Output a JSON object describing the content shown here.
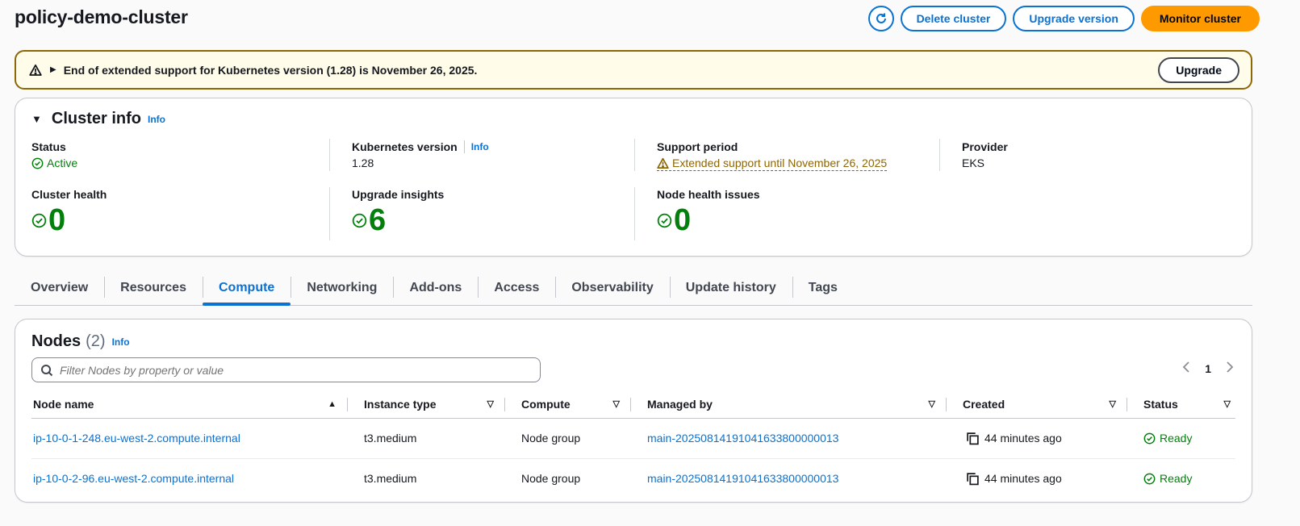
{
  "header": {
    "title": "policy-demo-cluster",
    "buttons": {
      "delete": "Delete cluster",
      "upgrade": "Upgrade version",
      "monitor": "Monitor cluster"
    }
  },
  "banner": {
    "message": "End of extended support for Kubernetes version (1.28) is November 26, 2025.",
    "action": "Upgrade"
  },
  "cluster_info": {
    "title": "Cluster info",
    "info_link": "Info",
    "status_label": "Status",
    "status_value": "Active",
    "k8s_label": "Kubernetes version",
    "k8s_info": "Info",
    "k8s_value": "1.28",
    "support_label": "Support period",
    "support_value": "Extended support until November 26, 2025",
    "provider_label": "Provider",
    "provider_value": "EKS",
    "health_label": "Cluster health",
    "health_value": "0",
    "insights_label": "Upgrade insights",
    "insights_value": "6",
    "node_issues_label": "Node health issues",
    "node_issues_value": "0"
  },
  "tabs": [
    "Overview",
    "Resources",
    "Compute",
    "Networking",
    "Add-ons",
    "Access",
    "Observability",
    "Update history",
    "Tags"
  ],
  "active_tab": "Compute",
  "nodes": {
    "title": "Nodes",
    "count": "(2)",
    "info_link": "Info",
    "filter_placeholder": "Filter Nodes by property or value",
    "page": "1",
    "columns": [
      "Node name",
      "Instance type",
      "Compute",
      "Managed by",
      "Created",
      "Status"
    ],
    "rows": [
      {
        "name": "ip-10-0-1-248.eu-west-2.compute.internal",
        "instance_type": "t3.medium",
        "compute": "Node group",
        "managed_by": "main-20250814191041633800000013",
        "created": "44 minutes ago",
        "status": "Ready"
      },
      {
        "name": "ip-10-0-2-96.eu-west-2.compute.internal",
        "instance_type": "t3.medium",
        "compute": "Node group",
        "managed_by": "main-20250814191041633800000013",
        "created": "44 minutes ago",
        "status": "Ready"
      }
    ]
  },
  "colors": {
    "accent": "#0972d3",
    "primary": "#ff9900",
    "success": "#037f0c",
    "warning": "#8d6605"
  }
}
